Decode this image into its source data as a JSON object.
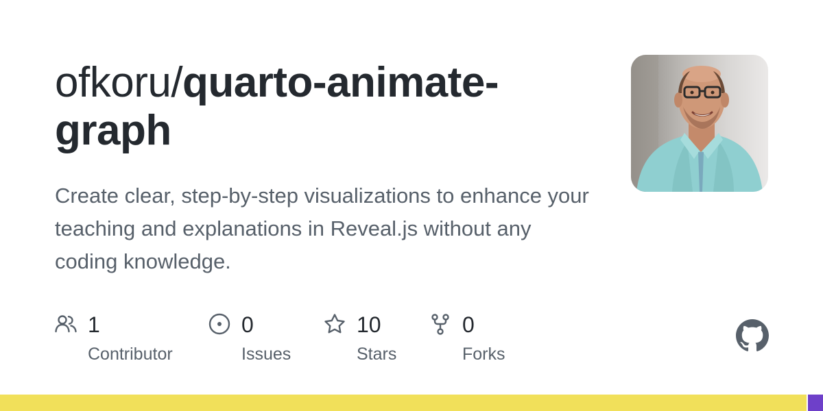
{
  "repo": {
    "owner": "ofkoru/",
    "name": "quarto-animate-graph",
    "description": "Create clear, step-by-step visualizations to enhance your teaching and explanations in Reveal.js without any coding knowledge."
  },
  "stats": [
    {
      "icon": "people-icon",
      "count": "1",
      "label": "Contributor"
    },
    {
      "icon": "issue-icon",
      "count": "0",
      "label": "Issues"
    },
    {
      "icon": "star-icon",
      "count": "10",
      "label": "Stars"
    },
    {
      "icon": "fork-icon",
      "count": "0",
      "label": "Forks"
    }
  ],
  "languages": [
    {
      "color": "#f1e05a",
      "share": 0.982
    },
    {
      "color": "#6e40c9",
      "share": 0.018
    }
  ],
  "colors": {
    "text": "#24292f",
    "muted": "#57606a",
    "icon": "#57606a"
  }
}
